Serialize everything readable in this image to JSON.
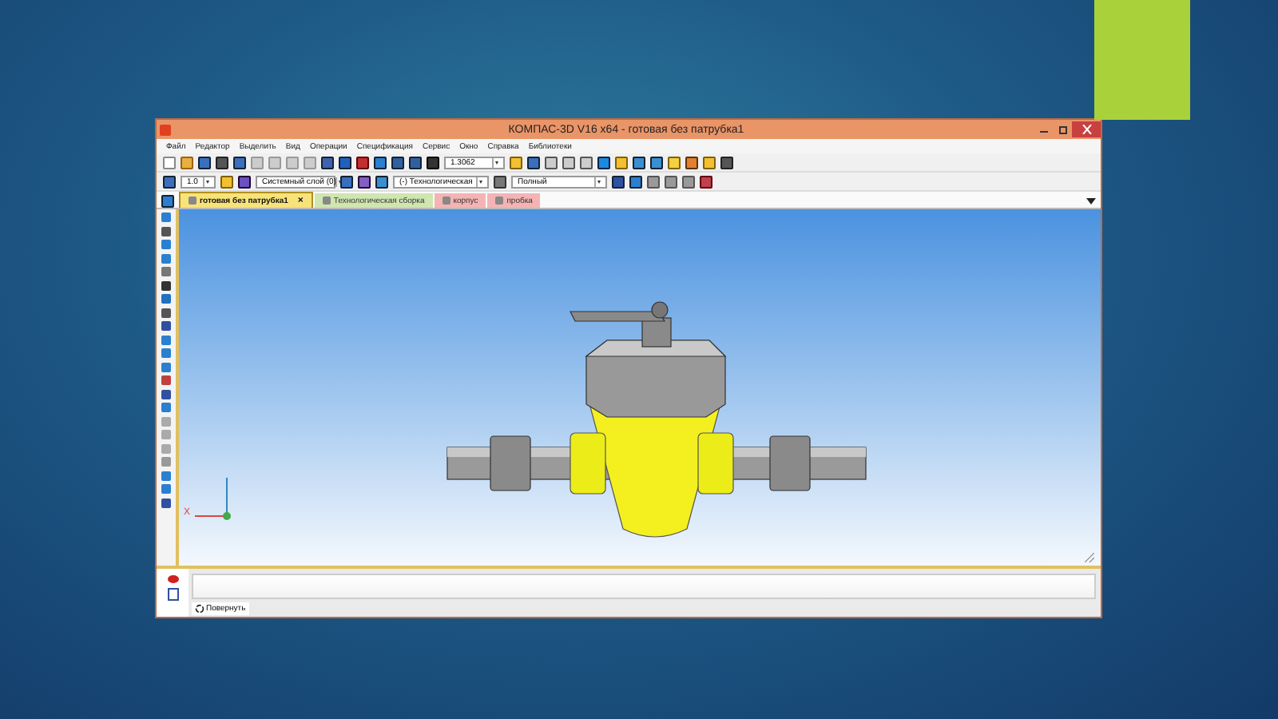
{
  "window": {
    "title": "КОМПАС-3D V16  x64 - готовая без патрубка1"
  },
  "menu": [
    "Файл",
    "Редактор",
    "Выделить",
    "Вид",
    "Операции",
    "Спецификация",
    "Сервис",
    "Окно",
    "Справка",
    "Библиотеки"
  ],
  "toolbar": {
    "scale": "1.3062"
  },
  "properties_bar": {
    "step": "1.0",
    "layer": "Системный слой (0)",
    "tech": "(-) Технологическая",
    "mode": "Полный"
  },
  "tabs": [
    {
      "label": "готовая без патрубка1",
      "selected": true,
      "color": "#f7e37a",
      "close": "×"
    },
    {
      "label": "Технологическая сборка",
      "selected": false,
      "color": "#cfe6b0"
    },
    {
      "label": "корпус",
      "selected": false,
      "color": "#f4b4b4"
    },
    {
      "label": "пробка",
      "selected": false,
      "color": "#f4b4b4"
    }
  ],
  "viewport": {
    "axis_label": "X"
  },
  "status": {
    "command_tab": "Повернуть"
  }
}
